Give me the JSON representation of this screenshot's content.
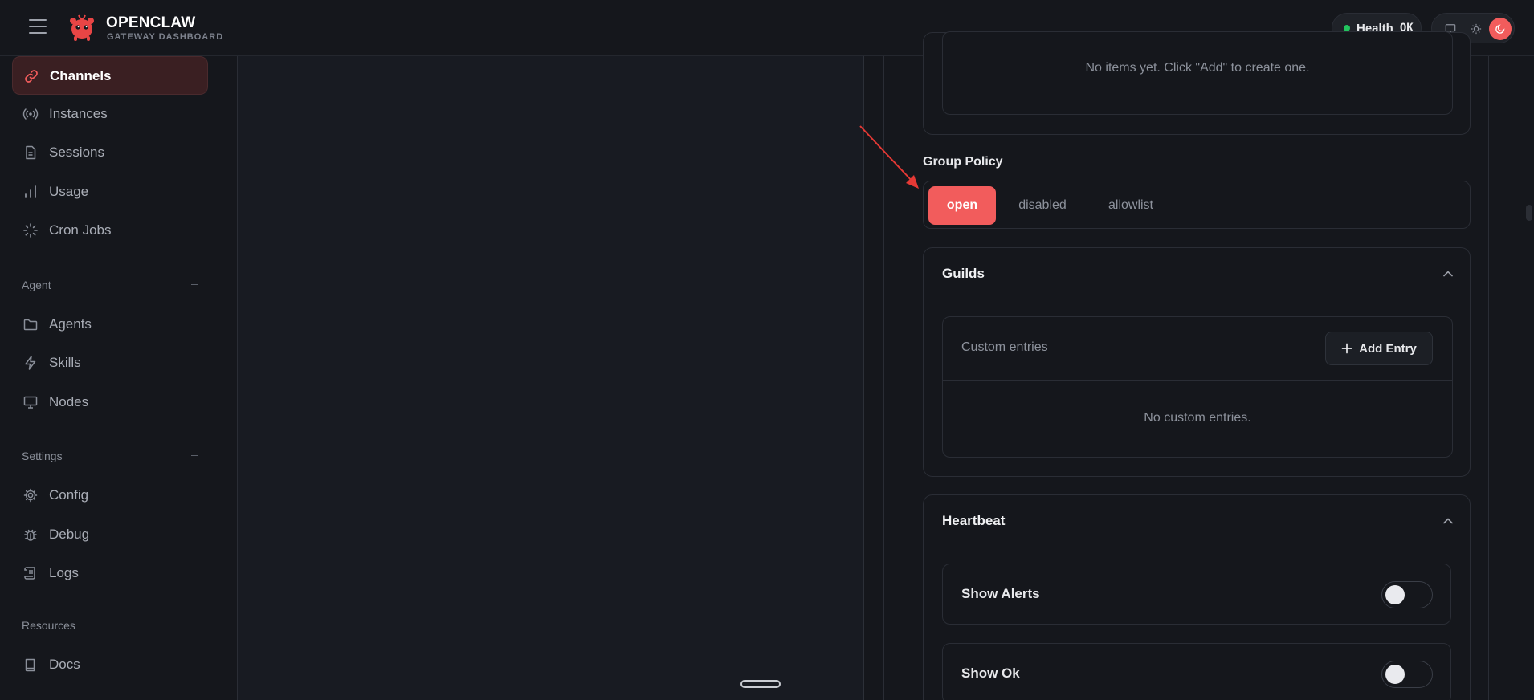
{
  "header": {
    "title": "OPENCLAW",
    "subtitle": "GATEWAY DASHBOARD",
    "health_label": "Health",
    "health_value": "OK",
    "accent": "#f25c5c",
    "status_color": "#22c55e"
  },
  "sidebar": {
    "items": [
      {
        "label": "Channels",
        "icon": "link-icon",
        "active": true
      },
      {
        "label": "Instances",
        "icon": "broadcast-icon"
      },
      {
        "label": "Sessions",
        "icon": "file-icon"
      },
      {
        "label": "Usage",
        "icon": "bar-chart-icon"
      },
      {
        "label": "Cron Jobs",
        "icon": "loader-icon"
      }
    ],
    "agent_section": "Agent",
    "agent_items": [
      {
        "label": "Agents",
        "icon": "folder-icon"
      },
      {
        "label": "Skills",
        "icon": "bolt-icon"
      },
      {
        "label": "Nodes",
        "icon": "monitor-icon"
      }
    ],
    "settings_section": "Settings",
    "settings_items": [
      {
        "label": "Config",
        "icon": "gear-icon"
      },
      {
        "label": "Debug",
        "icon": "bug-icon"
      },
      {
        "label": "Logs",
        "icon": "scroll-icon"
      }
    ],
    "resources_section": "Resources",
    "resources_items": [
      {
        "label": "Docs",
        "icon": "book-icon"
      }
    ]
  },
  "config": {
    "empty_items_note": "No items yet. Click \"Add\" to create one.",
    "group_policy": {
      "label": "Group Policy",
      "options": [
        "open",
        "disabled",
        "allowlist"
      ],
      "selected": "open"
    },
    "guilds": {
      "title": "Guilds",
      "custom_entries_label": "Custom entries",
      "add_button": "Add Entry",
      "empty_note": "No custom entries."
    },
    "heartbeat": {
      "title": "Heartbeat",
      "toggles": [
        {
          "label": "Show Alerts",
          "value": false
        },
        {
          "label": "Show Ok",
          "value": false
        }
      ]
    }
  }
}
